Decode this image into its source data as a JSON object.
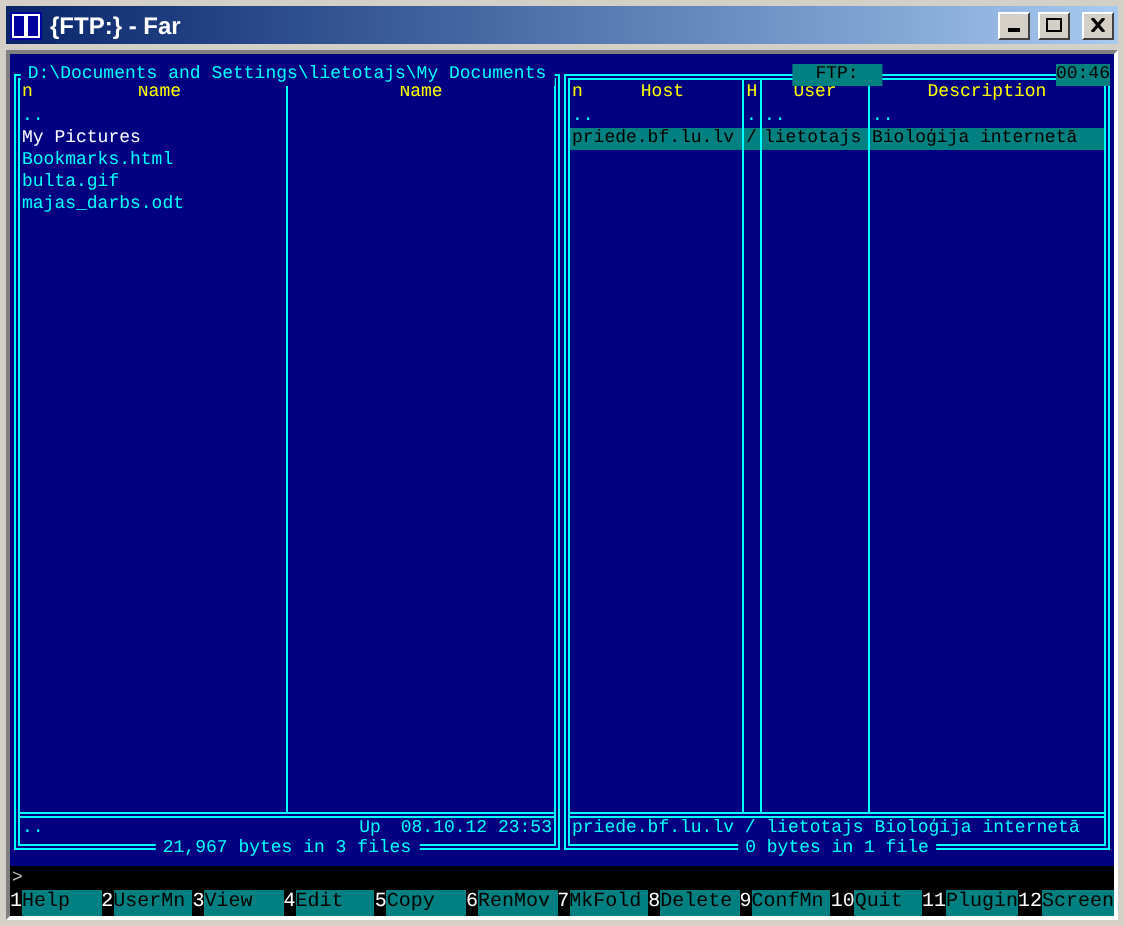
{
  "window": {
    "title": "{FTP:} - Far"
  },
  "left_panel": {
    "title": "D:\\Documents and Settings\\lietotajs\\My Documents",
    "mode": "n",
    "columns": [
      "Name",
      "Name"
    ],
    "files": [
      {
        "name": "..",
        "kind": "up"
      },
      {
        "name": "My Pictures",
        "kind": "folder"
      },
      {
        "name": "Bookmarks.html",
        "kind": "file"
      },
      {
        "name": "bulta.gif",
        "kind": "file"
      },
      {
        "name": "majas_darbs.odt",
        "kind": "file"
      }
    ],
    "info": {
      "name": "..",
      "type": "Up",
      "date": "08.10.12 23:53"
    },
    "summary": "21,967 bytes in 3 files"
  },
  "right_panel": {
    "title": "FTP:",
    "clock": "00:46",
    "mode": "n",
    "columns": [
      "Host",
      "H",
      "User",
      "Description"
    ],
    "rows": [
      {
        "cells": [
          "..",
          ".",
          "..",
          ".."
        ],
        "selected": false
      },
      {
        "cells": [
          "priede.bf.lu.lv",
          "/",
          "lietotajs",
          "Bioloģija internetā"
        ],
        "selected": true
      }
    ],
    "info": "priede.bf.lu.lv / lietotajs Bioloģija internetā",
    "summary": "0 bytes in 1 file"
  },
  "command_line": {
    "prompt": ">"
  },
  "keybar": [
    {
      "number": "1",
      "label": "Help"
    },
    {
      "number": "2",
      "label": "UserMn"
    },
    {
      "number": "3",
      "label": "View"
    },
    {
      "number": "4",
      "label": "Edit"
    },
    {
      "number": "5",
      "label": "Copy"
    },
    {
      "number": "6",
      "label": "RenMov"
    },
    {
      "number": "7",
      "label": "MkFold"
    },
    {
      "number": "8",
      "label": "Delete"
    },
    {
      "number": "9",
      "label": "ConfMn"
    },
    {
      "number": "10",
      "label": "Quit"
    },
    {
      "number": "11",
      "label": "Plugin"
    },
    {
      "number": "12",
      "label": "Screen"
    }
  ]
}
